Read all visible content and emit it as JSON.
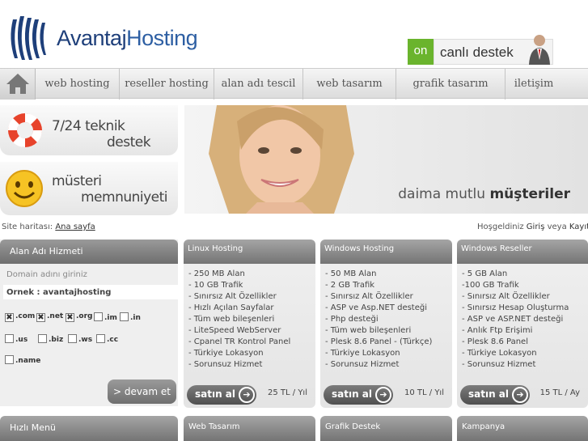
{
  "brand": {
    "name_a": "Avantaj",
    "name_b": "Hosting"
  },
  "support": {
    "on": "on",
    "label": "canlı destek"
  },
  "nav": {
    "home_icon": "home-icon",
    "items": [
      "web hosting",
      "reseller hosting",
      "alan adı tescil",
      "web tasarım",
      "grafik tasarım",
      "iletişim"
    ]
  },
  "features": [
    {
      "line1": "7/24 teknik",
      "line2": "destek",
      "icon": "lifebuoy-icon"
    },
    {
      "line1": "müsteri",
      "line2": "memnuniyeti",
      "icon": "smiley-icon"
    }
  ],
  "hero": {
    "slogan_a": "daima mutlu ",
    "slogan_b": "müşteriler"
  },
  "breadcrumb": {
    "label": "Site haritası:",
    "link": "Ana sayfa"
  },
  "welcome": {
    "text": "Hoşgeldiniz ",
    "login": "Giriş",
    "or": " veya ",
    "register": "Kayıt Ol"
  },
  "domain": {
    "title": "Alan Adı Hizmeti",
    "hint": "Domain adını giriniz",
    "input_value": "Örnek : avantajhosting",
    "extensions": [
      {
        "label": ".com",
        "checked": true
      },
      {
        "label": ".net",
        "checked": true
      },
      {
        "label": ".org",
        "checked": true
      },
      {
        "label": ".im",
        "checked": false
      },
      {
        "label": ".in",
        "checked": false
      },
      {
        "label": ".us",
        "checked": false
      },
      {
        "label": ".biz",
        "checked": false
      },
      {
        "label": ".ws",
        "checked": false
      },
      {
        "label": ".cc",
        "checked": false
      },
      {
        "label": ".name",
        "checked": false
      }
    ],
    "button": "> devam et"
  },
  "packages": [
    {
      "title": "Linux Hosting",
      "features": [
        "- 250 MB Alan",
        "- 10 GB Trafik",
        "- Sınırsız Alt Özellikler",
        "- Hızlı Açılan Sayfalar",
        "- Tüm web bileşenleri",
        "- LiteSpeed WebServer",
        "- Cpanel TR Kontrol Panel",
        "- Türkiye Lokasyon",
        "- Sorunsuz Hizmet"
      ],
      "buy": "satın al",
      "price": "25 TL / Yıl"
    },
    {
      "title": "Windows Hosting",
      "features": [
        "- 50 MB Alan",
        "- 2 GB Trafik",
        "- Sınırsız Alt Özellikler",
        "- ASP ve Asp.NET desteği",
        "- Php desteği",
        "- Tüm web bileşenleri",
        "- Plesk 8.6 Panel - (Türkçe)",
        "- Türkiye Lokasyon",
        "- Sorunsuz Hizmet"
      ],
      "buy": "satın al",
      "price": "10 TL / Yıl"
    },
    {
      "title": "Windows Reseller",
      "features": [
        "- 5 GB Alan",
        "-100 GB Trafik",
        "- Sınırsız Alt Özellikler",
        "- Sınırsız Hesap Oluşturma",
        "- ASP ve ASP.NET desteği",
        "- Anlık Ftp Erişimi",
        "- Plesk 8.6 Panel",
        "- Türkiye Lokasyon",
        "- Sorunsuz Hizmet"
      ],
      "buy": "satın al",
      "price": "15 TL / Ay"
    }
  ],
  "bottom": {
    "menu": "Hızlı Menü",
    "boxes": [
      "Web Tasarım",
      "Grafik Destek",
      "Kampanya"
    ]
  }
}
